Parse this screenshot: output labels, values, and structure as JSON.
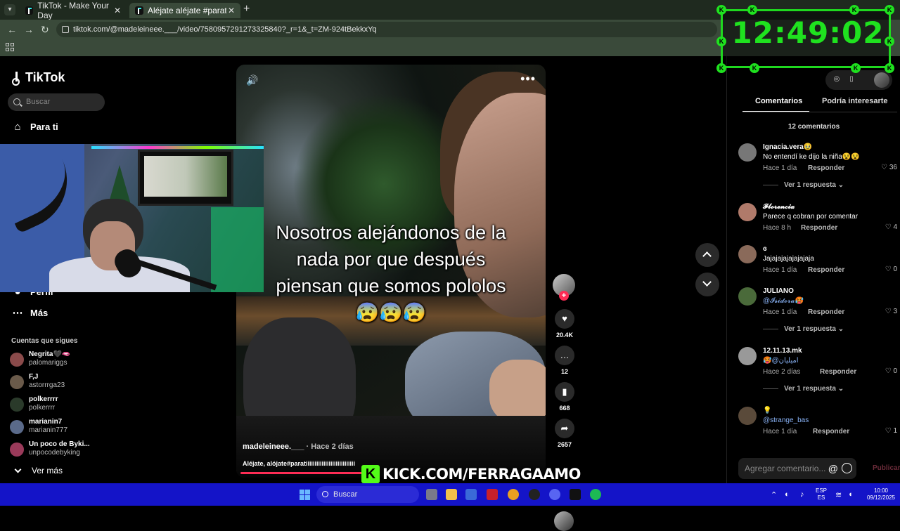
{
  "browser": {
    "tabs": [
      {
        "title": "TikTok - Make Your Day"
      },
      {
        "title": "Aléjate aléjate #paratiiiiiiiiiiiiiii"
      }
    ],
    "url": "tiktok.com/@madeleineee.___/video/7580957291273325840?_r=1&_t=ZM-924tBekkxYq"
  },
  "sidebar": {
    "logo": "TikTok",
    "search_placeholder": "Buscar",
    "nav": {
      "for_you": "Para ti",
      "profile": "Perfil",
      "more": "Más"
    },
    "following_title": "Cuentas que sigues",
    "accounts": [
      {
        "name": "Negrita🖤🫦",
        "handle": "palomariggs",
        "color": "#8a4a4a"
      },
      {
        "name": "F,J",
        "handle": "astorrrga23",
        "color": "#6a5a4a"
      },
      {
        "name": "polkerrrr",
        "handle": "polkerrrr",
        "color": "#2a3a2a"
      },
      {
        "name": "marianin7",
        "handle": "marianin777",
        "color": "#5a6a8a"
      },
      {
        "name": "Un poco de Byki...",
        "handle": "unpocodebyking",
        "color": "#9a3a5a"
      }
    ],
    "see_more": "Ver más"
  },
  "video": {
    "caption_lines": [
      "Nosotros alejándonos de la",
      "nada por que después",
      "piensan que somos pololos",
      "😰😰😰"
    ],
    "author": "madeleineee.___",
    "time": " · Hace 2 días",
    "description": "Aléjate, alójate#paratiiiiiiiiiiiiiiiiiiiiiiiiiiii",
    "progress_percent": 41
  },
  "actions": {
    "follow_plus": "+",
    "likes": "20.4K",
    "comments": "12",
    "saves": "668",
    "shares": "2657",
    "like_icon": "♥",
    "comment_icon": "…",
    "save_icon": "▮",
    "share_icon": "➦"
  },
  "panel": {
    "tabs": {
      "comments": "Comentarios",
      "related": "Podría interesarte"
    },
    "count": "12 comentarios",
    "reply_label": "Responder",
    "comments": [
      {
        "user": "Ignacia.vera🥹",
        "text": "No entendí ke dijo la niña😵😵",
        "time": "Hace 1 día",
        "likes": "36",
        "more": "Ver 1 respuesta",
        "color": "#777"
      },
      {
        "user": "𝓕𝓵𝓸𝓻𝓮𝓷𝓬𝓲𝓪",
        "text": "Parece q cobran por comentar",
        "time": "Hace 8 h",
        "likes": "4",
        "more": "",
        "color": "#b07a6a"
      },
      {
        "user": "ɞ",
        "text": "Jajajajajajajajaja",
        "time": "Hace 1 día",
        "likes": "0",
        "more": "",
        "color": "#8a6a5a"
      },
      {
        "user": "JULIANO",
        "text": "@𝓘𝓼𝓲𝓭𝓸𝓻𝓪🥵",
        "time": "Hace 1 día",
        "likes": "3",
        "more": "Ver 1 respuesta",
        "color": "#4a6a3a"
      },
      {
        "user": "12.11.13.mk",
        "text": "🥵@امیلیان",
        "time": "Hace 2 días",
        "likes": "0",
        "more": "Ver 1 respuesta",
        "color": "#999"
      },
      {
        "user": "💡",
        "text": "@strange_bas",
        "time": "Hace 1 día",
        "likes": "1",
        "more": "",
        "color": "#5a4a3a"
      }
    ],
    "add_comment_placeholder": "Agregar comentario...",
    "at_symbol": "@",
    "publish": "Publicar"
  },
  "overlay": {
    "clock": "12:49:02",
    "clock_marker": "K",
    "kick_letter": "K",
    "kick_text": "KICK.COM/FERRAGAAMO"
  },
  "taskbar": {
    "search": "Buscar",
    "lang_1": "ESP",
    "lang_2": "ES",
    "time": "10:00",
    "date": "09/12/2025"
  },
  "colors": {
    "accent": "#fe2c55",
    "clock": "#1fe21f",
    "taskbar": "#1414c8",
    "kick": "#53fc18"
  }
}
